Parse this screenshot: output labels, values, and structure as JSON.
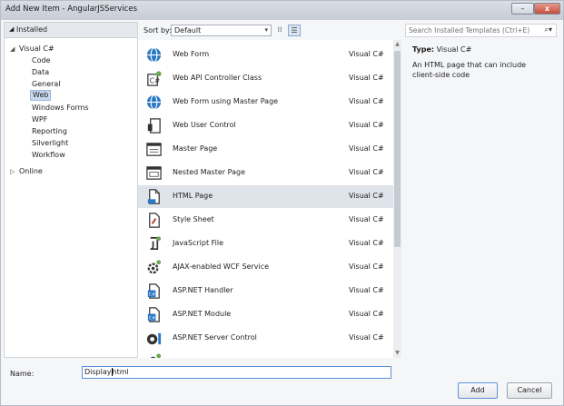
{
  "window": {
    "title": "Add New Item - AngularJSServices",
    "minimize_glyph": "–",
    "close_glyph": "x"
  },
  "tree": {
    "header": "Installed",
    "items": [
      {
        "label": "Visual C#",
        "expanded": true
      },
      {
        "label": "Code"
      },
      {
        "label": "Data"
      },
      {
        "label": "General"
      },
      {
        "label": "Web",
        "selected": true
      },
      {
        "label": "Windows Forms"
      },
      {
        "label": "WPF"
      },
      {
        "label": "Reporting"
      },
      {
        "label": "Silverlight"
      },
      {
        "label": "Workflow"
      },
      {
        "label": "Online",
        "expanded": false
      }
    ]
  },
  "toolbar": {
    "sort_label": "Sort by:",
    "sort_value": "Default"
  },
  "templates": [
    {
      "name": "Web Form",
      "lang": "Visual C#",
      "icon": "globe-icon"
    },
    {
      "name": "Web API Controller Class",
      "lang": "Visual C#",
      "icon": "controller-icon"
    },
    {
      "name": "Web Form using Master Page",
      "lang": "Visual C#",
      "icon": "globe-icon"
    },
    {
      "name": "Web User Control",
      "lang": "Visual C#",
      "icon": "user-control-icon"
    },
    {
      "name": "Master Page",
      "lang": "Visual C#",
      "icon": "master-page-icon"
    },
    {
      "name": "Nested Master Page",
      "lang": "Visual C#",
      "icon": "master-page-icon"
    },
    {
      "name": "HTML Page",
      "lang": "Visual C#",
      "icon": "html-page-icon",
      "selected": true
    },
    {
      "name": "Style Sheet",
      "lang": "Visual C#",
      "icon": "style-sheet-icon"
    },
    {
      "name": "JavaScript File",
      "lang": "Visual C#",
      "icon": "javascript-file-icon"
    },
    {
      "name": "AJAX-enabled WCF Service",
      "lang": "Visual C#",
      "icon": "wcf-service-icon"
    },
    {
      "name": "ASP.NET Handler",
      "lang": "Visual C#",
      "icon": "handler-icon"
    },
    {
      "name": "ASP.NET Module",
      "lang": "Visual C#",
      "icon": "module-icon"
    },
    {
      "name": "ASP.NET Server Control",
      "lang": "Visual C#",
      "icon": "server-control-icon"
    },
    {
      "name": "",
      "lang": "",
      "icon": "partial-item-icon"
    }
  ],
  "search": {
    "placeholder": "Search Installed Templates (Ctrl+E)"
  },
  "details": {
    "type_label": "Type:",
    "type_value": "Visual C#",
    "description": "An HTML page that can include client-side code"
  },
  "name_field": {
    "label": "Name:",
    "value_before_caret": "Display",
    "value_after_caret": "html"
  },
  "buttons": {
    "add": "Add",
    "cancel": "Cancel"
  },
  "colors": {
    "selection": "#dfe3ea",
    "tree_selection": "#c8d8ee",
    "focus_border": "#5b8fd6"
  }
}
